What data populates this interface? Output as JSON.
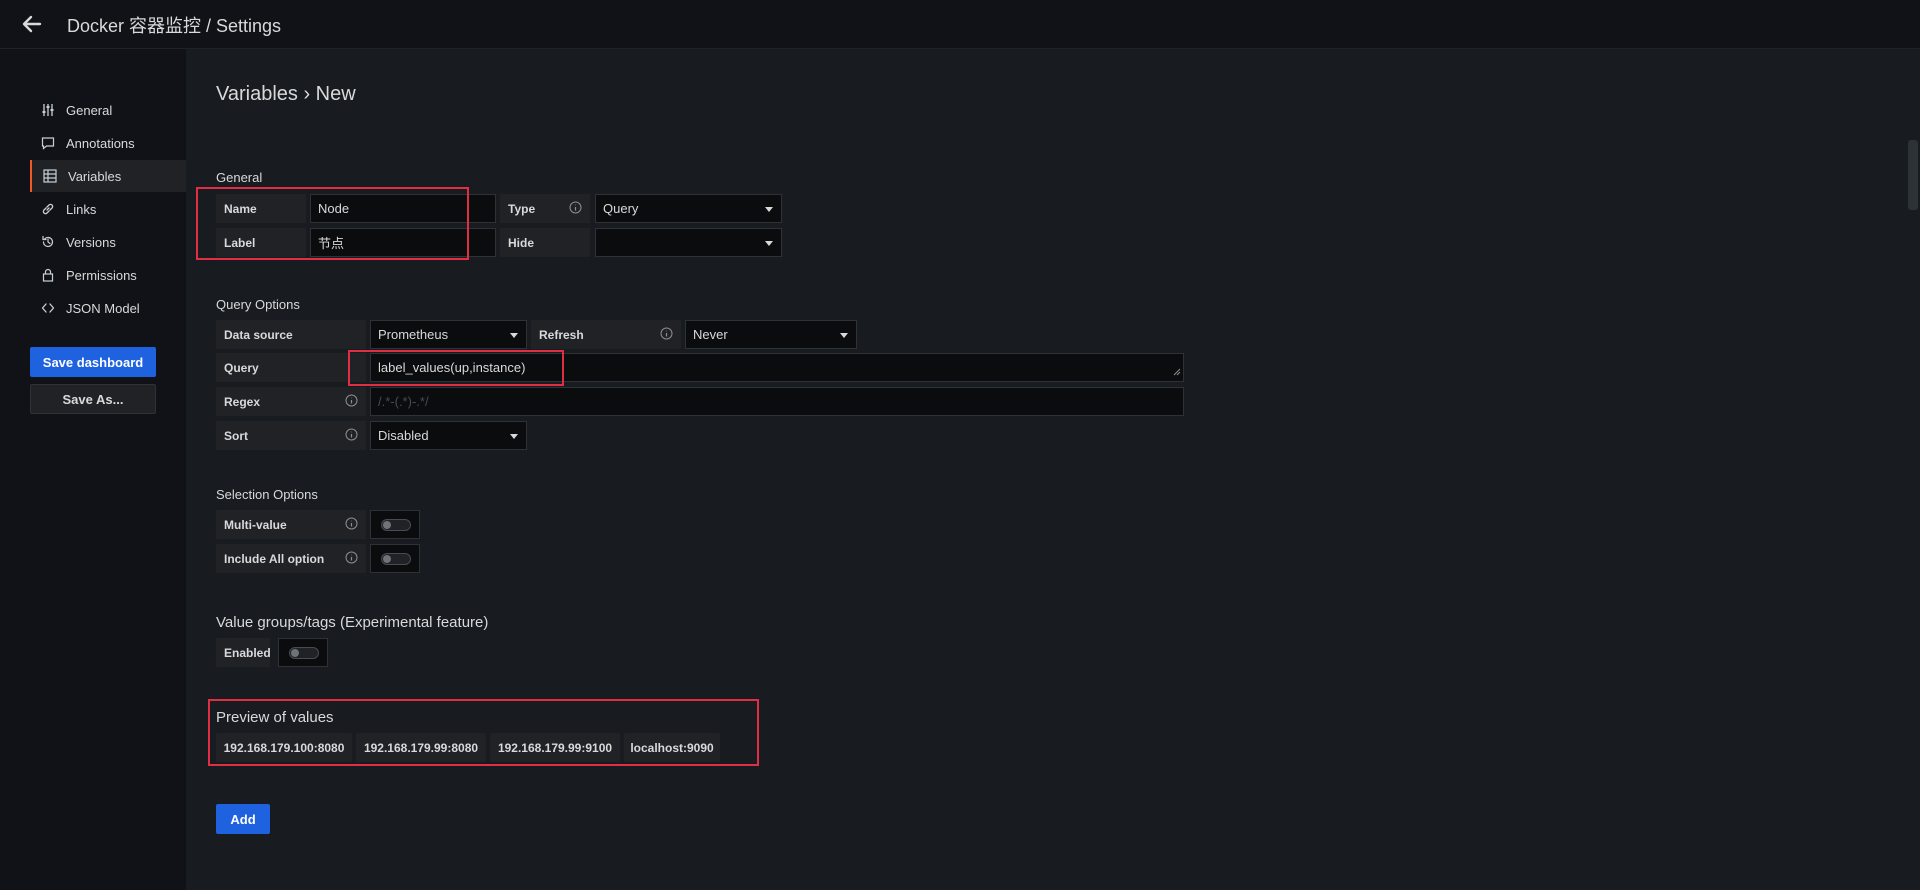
{
  "header": {
    "title": "Docker 容器监控 / Settings"
  },
  "sidebar": {
    "items": [
      {
        "label": "General",
        "icon": "sliders-icon"
      },
      {
        "label": "Annotations",
        "icon": "comment-icon"
      },
      {
        "label": "Variables",
        "icon": "table-icon",
        "active": true
      },
      {
        "label": "Links",
        "icon": "link-icon"
      },
      {
        "label": "Versions",
        "icon": "history-icon"
      },
      {
        "label": "Permissions",
        "icon": "lock-icon"
      },
      {
        "label": "JSON Model",
        "icon": "code-icon"
      }
    ],
    "save_dashboard": "Save dashboard",
    "save_as": "Save As..."
  },
  "page": {
    "title": "Variables › New"
  },
  "general": {
    "section": "General",
    "name_label": "Name",
    "name_value": "Node",
    "type_label": "Type",
    "type_value": "Query",
    "label_label": "Label",
    "label_value": "节点",
    "hide_label": "Hide",
    "hide_value": ""
  },
  "query_options": {
    "section": "Query Options",
    "datasource_label": "Data source",
    "datasource_value": "Prometheus",
    "refresh_label": "Refresh",
    "refresh_value": "Never",
    "query_label": "Query",
    "query_value": "label_values(up,instance)",
    "regex_label": "Regex",
    "regex_placeholder": "/.*-(.*)-.*/",
    "sort_label": "Sort",
    "sort_value": "Disabled"
  },
  "selection_options": {
    "section": "Selection Options",
    "multi_value_label": "Multi-value",
    "include_all_label": "Include All option"
  },
  "value_groups": {
    "section": "Value groups/tags (Experimental feature)",
    "enabled_label": "Enabled"
  },
  "preview": {
    "section": "Preview of values",
    "values": [
      "192.168.179.100:8080",
      "192.168.179.99:8080",
      "192.168.179.99:9100",
      "localhost:9090"
    ]
  },
  "add_button": "Add",
  "colors": {
    "primary": "#1f62e0",
    "active_accent": "#f05a28",
    "highlight": "#e02f44"
  }
}
